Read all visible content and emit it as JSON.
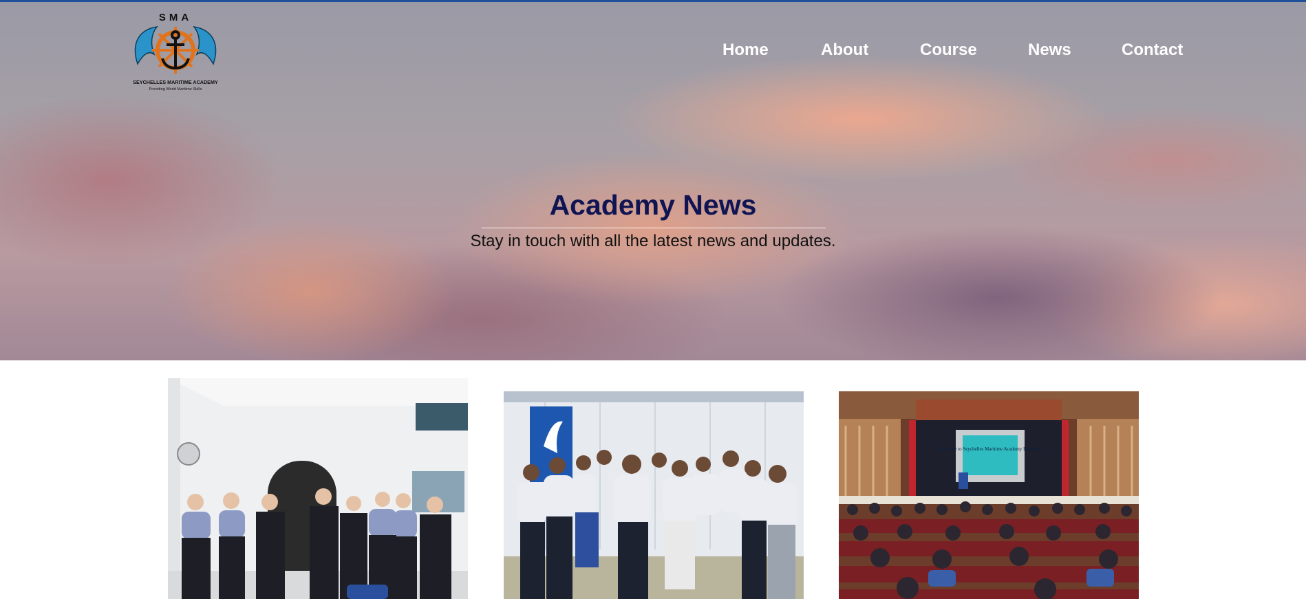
{
  "header": {
    "logo": {
      "top_text": "SMA",
      "name": "SEYCHELLES MARITIME ACADEMY",
      "tagline": "Providing World Maritime Skills",
      "icon": "anchor-helm-dolphins-icon"
    },
    "nav": [
      {
        "label": "Home"
      },
      {
        "label": "About"
      },
      {
        "label": "Course"
      },
      {
        "label": "News"
      },
      {
        "label": "Contact"
      }
    ]
  },
  "hero": {
    "title": "Academy News",
    "subtitle": "Stay in touch with all the latest news and updates.",
    "background": "sunset-clouds-image"
  },
  "news": {
    "cards": [
      {
        "image": "staff-group-photo-indoors"
      },
      {
        "image": "graduates-group-photo-outdoors"
      },
      {
        "image": "auditorium-induction",
        "screen_text": "Welcome to Seychelles Maritime Academy Induction"
      }
    ]
  },
  "colors": {
    "accent_line": "#1f4f9a",
    "title": "#101452",
    "nav_text": "#ffffff"
  }
}
